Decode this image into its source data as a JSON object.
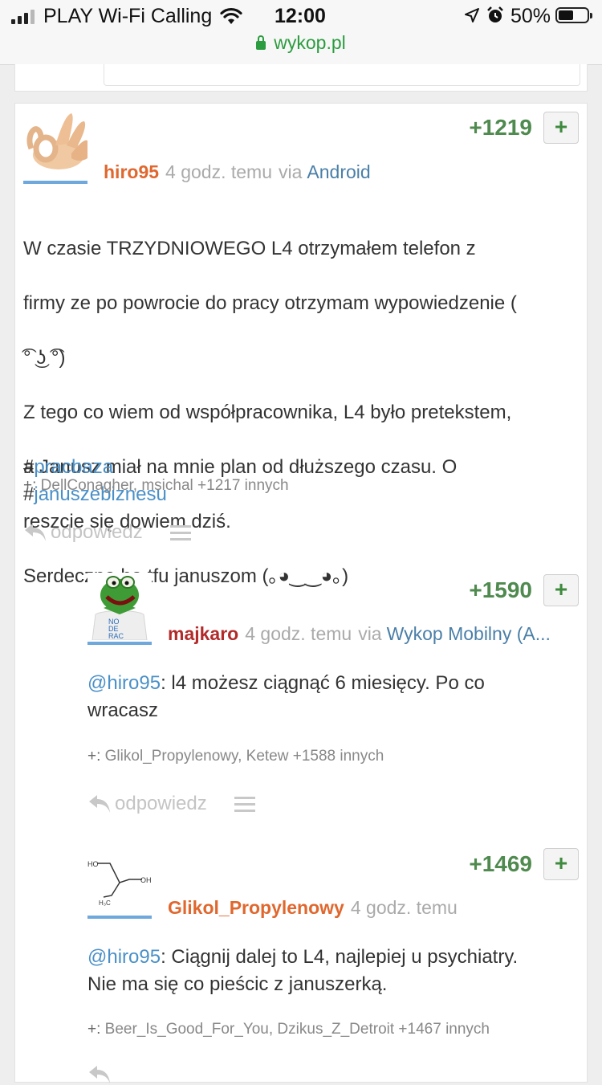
{
  "status_bar": {
    "carrier": "PLAY Wi-Fi Calling",
    "time": "12:00",
    "battery_percent": "50%",
    "url": "wykop.pl"
  },
  "entry": {
    "author": "hiro95",
    "time": "4 godz. temu",
    "via_label": "via",
    "via_app": "Android",
    "score": "+1219",
    "plus_button": "+",
    "body_lines": [
      "W czasie TRZYDNIOWEGO L4 otrzymałem telefon z",
      "firmy ze po powrocie do pracy otrzymam wypowiedzenie (",
      "͡° ͜ʖ ͡°)",
      "Z tego co wiem od współpracownika, L4 było pretekstem,",
      "a Janusz miał na mnie plan od dłuższego czasu. O",
      "reszcie się dowiem dziś.",
      "Serdeczne ha tfu januszom (｡◕‿‿◕｡)"
    ],
    "tags": [
      {
        "hash": "#",
        "name": "pracbaza"
      },
      {
        "hash": "#",
        "name": "januszebiznesu"
      }
    ],
    "plusers_prefix": "+:",
    "plusers": "DellConagher, msichal +1217 innych",
    "reply_label": "odpowiedz"
  },
  "comments": [
    {
      "author": "majkaro",
      "time": "4 godz. temu",
      "via_label": "via",
      "via_app": "Wykop Mobilny (A...",
      "score": "+1590",
      "plus_button": "+",
      "mention": "@hiro95",
      "text": ": l4 możesz ciągnąć 6 miesięcy. Po co\nwracasz",
      "plusers_prefix": "+:",
      "plusers": "Glikol_Propylenowy, Ketew +1588 innych",
      "reply_label": "odpowiedz"
    },
    {
      "author": "Glikol_Propylenowy",
      "time": "4 godz. temu",
      "score": "+1469",
      "plus_button": "+",
      "mention": "@hiro95",
      "text": ": Ciągnij dalej to L4, najlepiej u psychiatry.\nNie ma się co pieścic z januszerką.",
      "plusers_prefix": "+:",
      "plusers": "Beer_Is_Good_For_You, Dzikus_Z_Detroit +1467 innych",
      "avatar_labels": [
        "HO",
        "OH",
        "H₃C"
      ]
    }
  ],
  "colors": {
    "score_green": "#4f8a4f",
    "author_orange": "#e0672e",
    "author_red": "#b22a2a",
    "link_blue": "#4a90c8",
    "url_green": "#2b9c3f"
  }
}
